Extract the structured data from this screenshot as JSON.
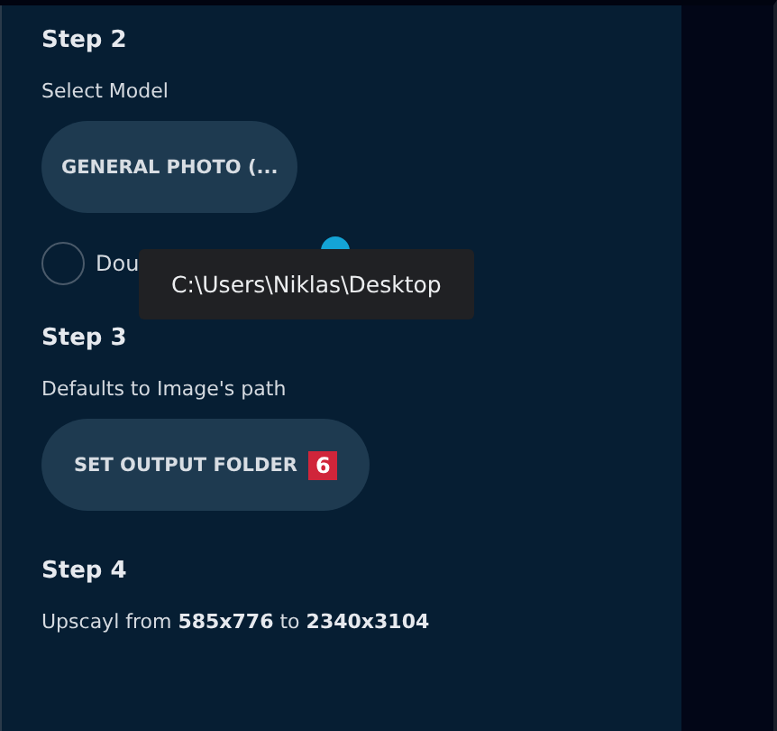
{
  "steps": [
    {
      "kind": "model",
      "title": "Step 2",
      "label": "Select Model",
      "button": "GENERAL PHOTO (...",
      "option": {
        "label": "Dou",
        "checked": false
      },
      "tooltip": "C:\\Users\\Niklas\\Desktop"
    },
    {
      "kind": "folder",
      "title": "Step 3",
      "label": "Defaults to Image's path",
      "button": "SET OUTPUT FOLDER",
      "badge": "6"
    },
    {
      "kind": "info",
      "title": "Step 4",
      "label": "Upscayl from **585x776** to **2340x3104**"
    }
  ]
}
